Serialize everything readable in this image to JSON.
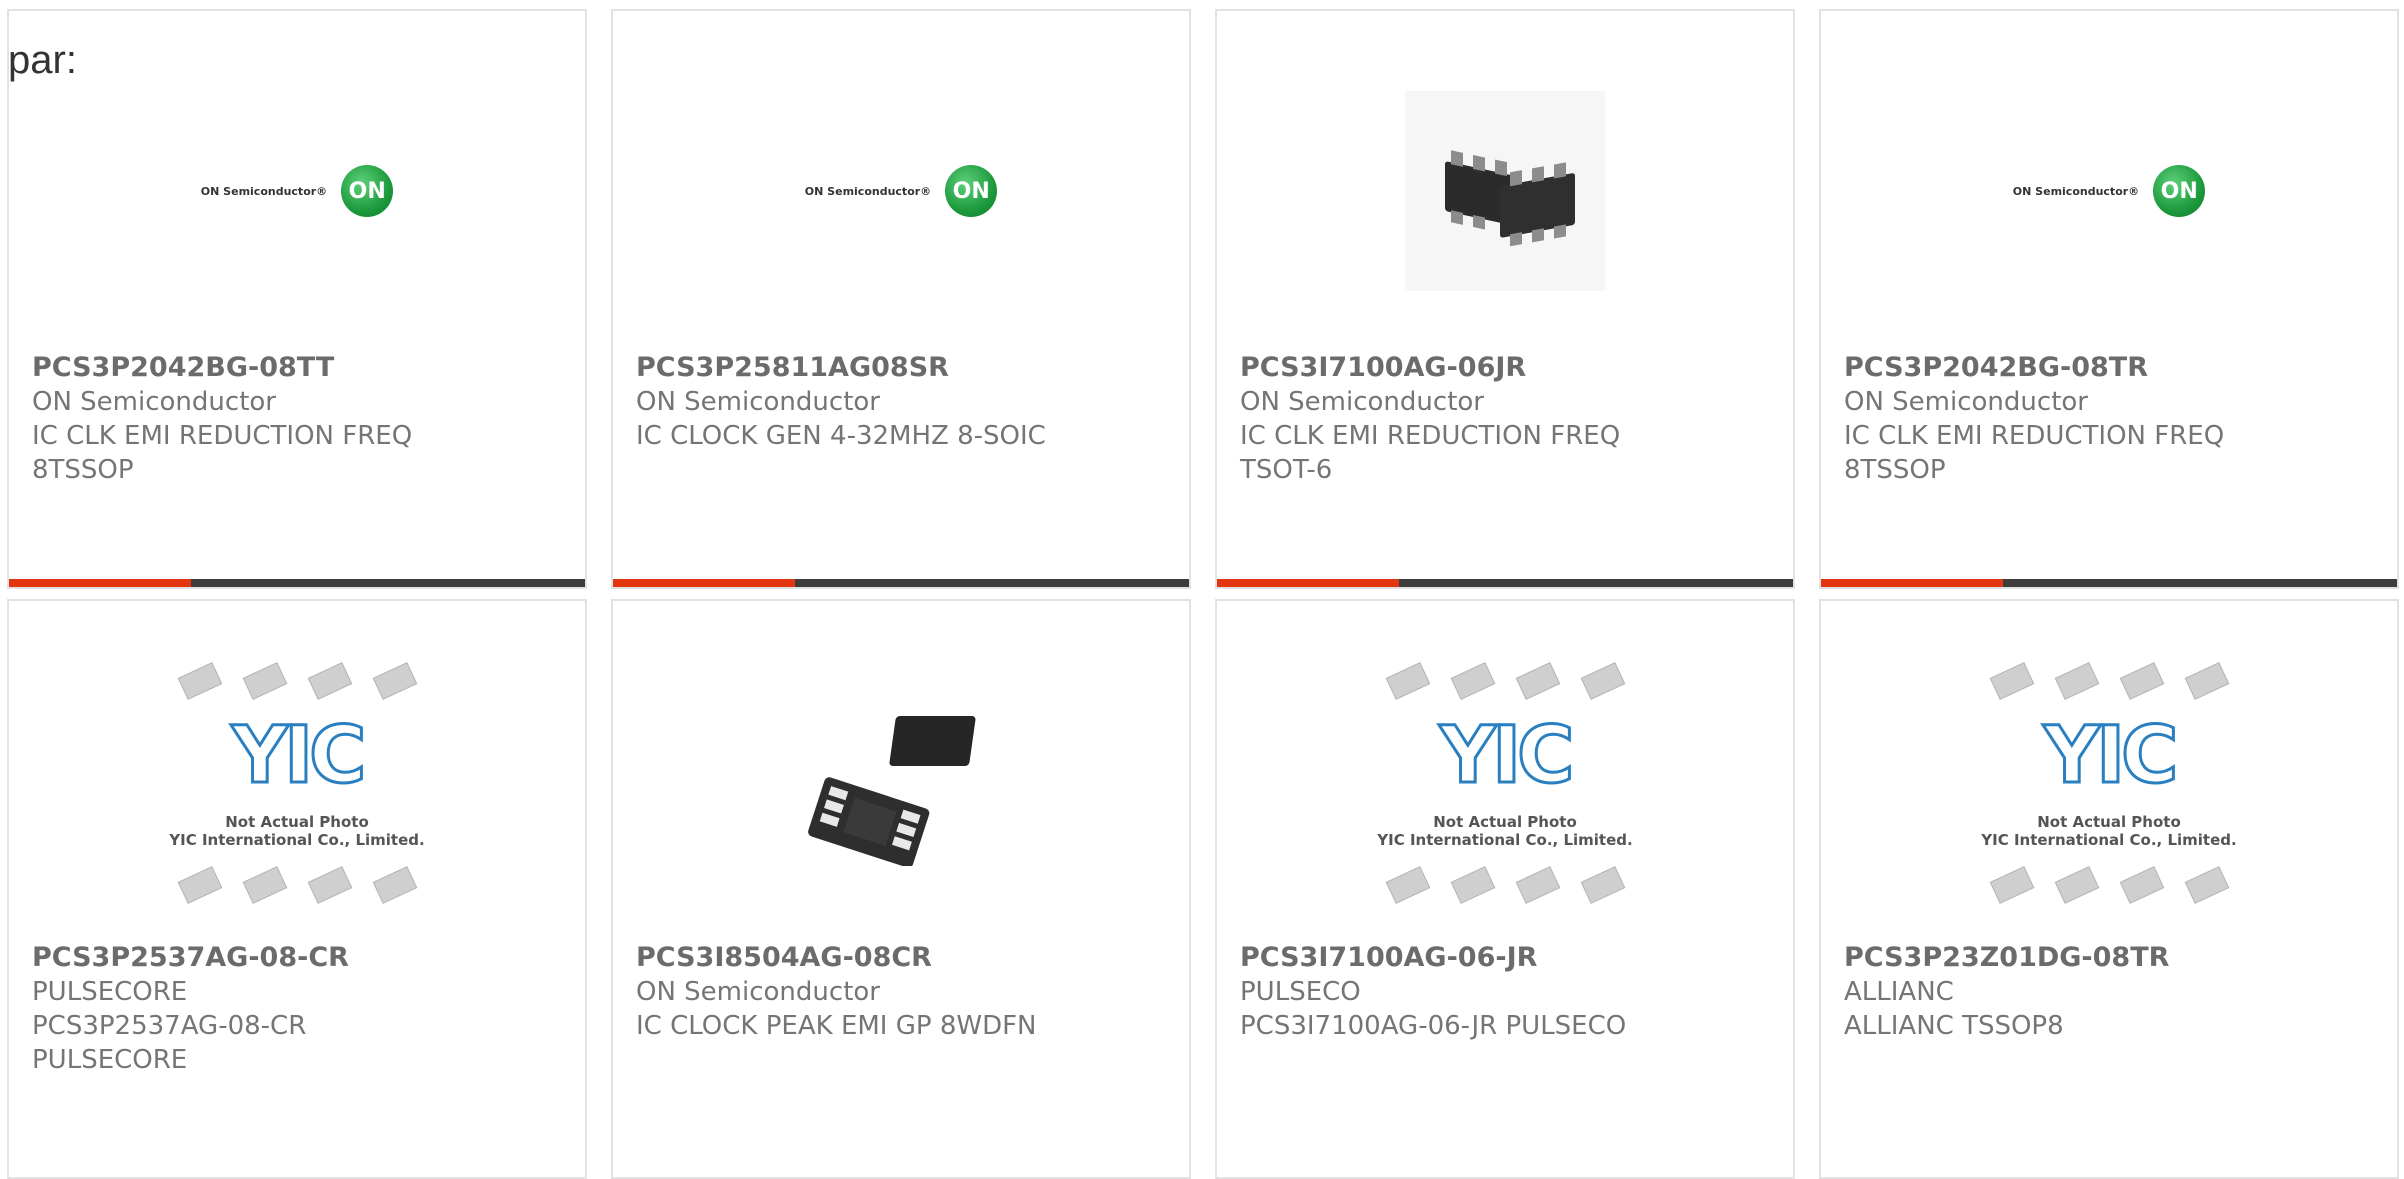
{
  "page_label": "par:",
  "logos": {
    "on_word": "ON Semiconductor®",
    "on_mark": "ON"
  },
  "placeholder": {
    "logo_text": "YIC",
    "line1": "Not Actual Photo",
    "line2": "YIC International Co., Limited."
  },
  "products": [
    {
      "part": "PCS3P2042BG-08TT",
      "maker": "ON Semiconductor",
      "desc": "IC CLK EMI REDUCTION FREQ 8TSSOP",
      "image": "on-logo"
    },
    {
      "part": "PCS3P25811AG08SR",
      "maker": "ON Semiconductor",
      "desc": "IC CLOCK GEN 4-32MHZ 8-SOIC",
      "image": "on-logo"
    },
    {
      "part": "PCS3I7100AG-06JR",
      "maker": "ON Semiconductor",
      "desc": "IC CLK EMI REDUCTION FREQ TSOT-6",
      "image": "tsot-photo"
    },
    {
      "part": "PCS3P2042BG-08TR",
      "maker": "ON Semiconductor",
      "desc": "IC CLK EMI REDUCTION FREQ 8TSSOP",
      "image": "on-logo"
    },
    {
      "part": "PCS3P2537AG-08-CR",
      "maker": "PULSECORE",
      "desc": "PCS3P2537AG-08-CR PULSECORE",
      "image": "yic-placeholder"
    },
    {
      "part": "PCS3I8504AG-08CR",
      "maker": "ON Semiconductor",
      "desc": "IC CLOCK PEAK EMI GP 8WDFN",
      "image": "wdfn-photo"
    },
    {
      "part": "PCS3I7100AG-06-JR",
      "maker": "PULSECO",
      "desc": "PCS3I7100AG-06-JR PULSECO",
      "image": "yic-placeholder"
    },
    {
      "part": "PCS3P23Z01DG-08TR",
      "maker": "ALLIANC",
      "desc": "ALLIANC TSSOP8",
      "image": "yic-placeholder"
    }
  ],
  "colors": {
    "accent": "#e2360f",
    "bar": "#3d3d3d",
    "border": "#e2e2e2"
  }
}
